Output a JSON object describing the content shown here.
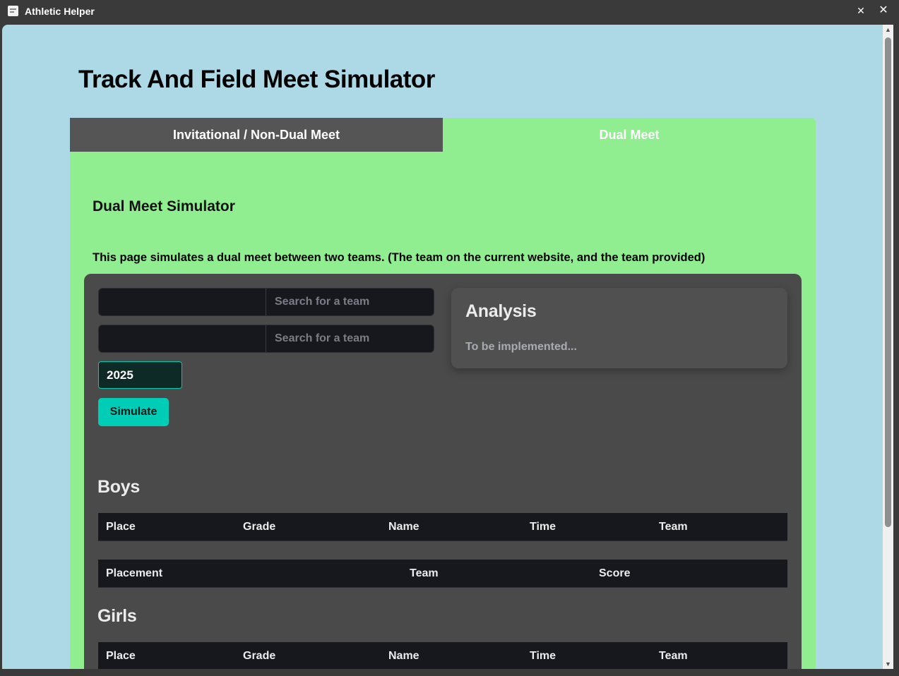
{
  "window": {
    "title": "Athletic Helper",
    "icons": {
      "app": "app-icon",
      "pin": "unpin-icon",
      "close": "close-icon"
    }
  },
  "page": {
    "title": "Track And Field Meet Simulator"
  },
  "tabs": [
    {
      "label": "Invitational / Non-Dual Meet",
      "active": false
    },
    {
      "label": "Dual Meet",
      "active": true
    }
  ],
  "dual_meet": {
    "heading": "Dual Meet Simulator",
    "description": "This page simulates a dual meet between two teams. (The team on the current website, and the team provided)",
    "search_team_1": {
      "value": "",
      "placeholder": "Search for a team"
    },
    "search_team_2": {
      "value": "",
      "placeholder": "Search for a team"
    },
    "year": "2025",
    "simulate_label": "Simulate",
    "analysis": {
      "title": "Analysis",
      "text": "To be implemented..."
    },
    "boys": {
      "heading": "Boys",
      "results_columns": [
        "Place",
        "Grade",
        "Name",
        "Time",
        "Team"
      ],
      "score_columns": [
        "Placement",
        "Team",
        "Score"
      ]
    },
    "girls": {
      "heading": "Girls",
      "results_columns": [
        "Place",
        "Grade",
        "Name",
        "Time",
        "Team"
      ]
    }
  },
  "colors": {
    "background": "#add8e6",
    "tab_inactive": "#555555",
    "tab_active": "#90ee90",
    "card": "#4a4a4a",
    "table_header": "#16181d",
    "accent": "#00cdb5"
  }
}
